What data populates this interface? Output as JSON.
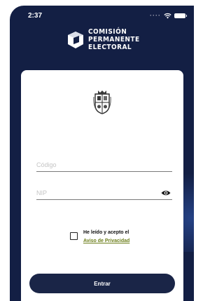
{
  "status_bar": {
    "time": "2:37",
    "dots": "····"
  },
  "brand": {
    "line1": "COMISIÓN",
    "line2": "PERMANENTE",
    "line3": "ELECTORAL"
  },
  "form": {
    "code_placeholder": "Código",
    "nip_placeholder": "NIP",
    "terms_text": "He leído y acepto el",
    "terms_link": "Aviso de Privacidad",
    "submit_label": "Entrar"
  },
  "colors": {
    "background": "#131f44",
    "card": "#ffffff",
    "button": "#1a2547",
    "link": "#6c7e1a"
  },
  "icons": [
    "wifi-icon",
    "battery-icon",
    "brand-logo",
    "university-crest",
    "eye-icon",
    "checkbox"
  ]
}
